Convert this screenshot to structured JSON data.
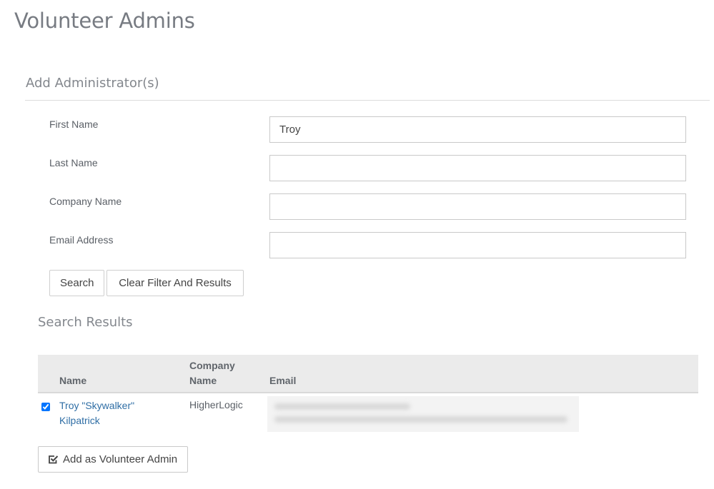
{
  "page": {
    "title": "Volunteer Admins"
  },
  "add_section": {
    "title": "Add Administrator(s)",
    "fields": {
      "first_name": {
        "label": "First Name",
        "value": "Troy",
        "placeholder": ""
      },
      "last_name": {
        "label": "Last Name",
        "value": "",
        "placeholder": ""
      },
      "company_name": {
        "label": "Company Name",
        "value": "",
        "placeholder": ""
      },
      "email_address": {
        "label": "Email Address",
        "value": "",
        "placeholder": ""
      }
    },
    "buttons": {
      "search": "Search",
      "clear": "Clear Filter And Results"
    }
  },
  "results": {
    "title": "Search Results",
    "columns": {
      "name": "Name",
      "company_line1": "Company",
      "company_line2": "Name",
      "email": "Email"
    },
    "rows": [
      {
        "checked": true,
        "name_line1": "Troy \"Skywalker\"",
        "name_line2": "Kilpatrick",
        "company": "HigherLogic",
        "email": ""
      }
    ],
    "add_button": {
      "label": "Add as Volunteer Admin",
      "icon": "check-square-icon"
    }
  },
  "colors": {
    "link": "#2f6ea5",
    "header_bg": "#ebebeb"
  }
}
